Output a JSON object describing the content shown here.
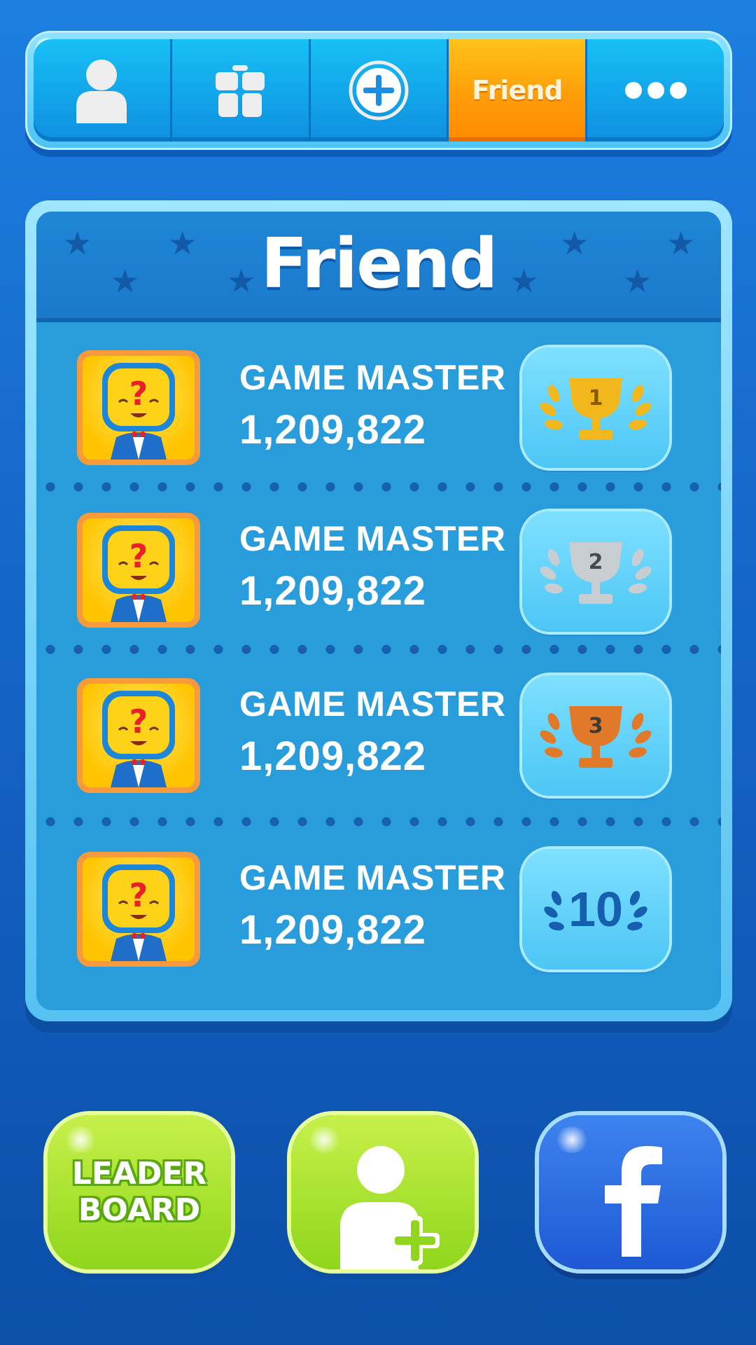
{
  "tabs": [
    {
      "icon": "user-icon",
      "label": ""
    },
    {
      "icon": "gift-icon",
      "label": ""
    },
    {
      "icon": "plus-circle-icon",
      "label": ""
    },
    {
      "icon": "",
      "label": "Friend",
      "active": true
    },
    {
      "icon": "more-dots-icon",
      "label": ""
    }
  ],
  "panel": {
    "title": "Friend"
  },
  "friends": [
    {
      "name": "GAME MASTER",
      "score": "1,209,822",
      "rank": "1",
      "badge": "gold-trophy-icon"
    },
    {
      "name": "GAME MASTER",
      "score": "1,209,822",
      "rank": "2",
      "badge": "silver-trophy-icon"
    },
    {
      "name": "GAME MASTER",
      "score": "1,209,822",
      "rank": "3",
      "badge": "bronze-trophy-icon"
    },
    {
      "name": "GAME MASTER",
      "score": "1,209,822",
      "rank": "10",
      "badge": "laurel-rank-icon"
    }
  ],
  "bottom": {
    "leaderboard_line1": "LEADER",
    "leaderboard_line2": "BOARD",
    "add_friend_icon": "add-user-icon",
    "facebook_icon": "facebook-icon"
  },
  "colors": {
    "active_tab": "#ff9a08",
    "gold": "#f2b71d",
    "silver": "#c8cdd2",
    "bronze": "#e07a2a",
    "green_button": "#a8e02a",
    "facebook_blue": "#2660d8"
  }
}
